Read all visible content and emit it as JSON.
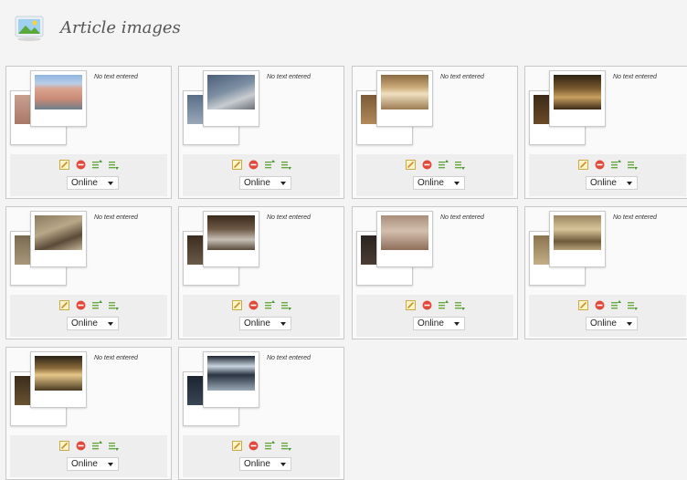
{
  "header": {
    "title": "Article images",
    "icon": "image-gallery-icon"
  },
  "cards": [
    {
      "note": "No text entered",
      "status": "Online",
      "front": "linear-gradient(180deg,#8fb4e0 0%,#b9cfe8 25%,#d9a48f 40%,#c98a76 70%,#6d7f8a 100%)",
      "back": "linear-gradient(180deg,#c9a090,#a87868)"
    },
    {
      "note": "No text entered",
      "status": "Online",
      "front": "linear-gradient(160deg,#4b5f7a 0%,#7d8fa3 45%,#c9ccd0 70%,#6b6f78 100%)",
      "back": "linear-gradient(180deg,#5a6e88,#9aa8b8)"
    },
    {
      "note": "No text entered",
      "status": "Online",
      "front": "linear-gradient(180deg,#8a6a42 0%,#c9a877 35%,#f0e0c0 55%,#9c7c52 100%)",
      "back": "linear-gradient(180deg,#7a5a38,#b28a5a)"
    },
    {
      "note": "No text entered",
      "status": "Online",
      "front": "linear-gradient(180deg,#2e2214 0%,#7a5a30 40%,#c8a060 65%,#3a2a18 100%)",
      "back": "linear-gradient(180deg,#3a2a18,#6a4a28)"
    },
    {
      "note": "No text entered",
      "status": "Online",
      "front": "linear-gradient(160deg,#8a7a60 0%,#b9a888 40%,#5a4a38 70%,#c4b49a 100%)",
      "back": "linear-gradient(180deg,#7a6a52,#a89878)"
    },
    {
      "note": "No text entered",
      "status": "Online",
      "front": "linear-gradient(180deg,#3a2a1c 0%,#6e5a46 40%,#c7c0b6 70%,#5a4a3a 100%)",
      "back": "linear-gradient(180deg,#3c2c20,#6a5a48)"
    },
    {
      "note": "No text entered",
      "status": "Online",
      "front": "linear-gradient(180deg,#a98e7a 0%,#d4bfae 45%,#8e6e5a 100%)",
      "back": "linear-gradient(180deg,#2a2420,#4a3c34)"
    },
    {
      "note": "No text entered",
      "status": "Online",
      "front": "linear-gradient(180deg,#9a8560 0%,#d8c49a 40%,#6e5a3a 75%,#b7a27a 100%)",
      "back": "linear-gradient(180deg,#8a7450,#c4ae86)"
    },
    {
      "note": "No text entered",
      "status": "Online",
      "front": "linear-gradient(180deg,#2a2216 0%,#8a6a3c 35%,#e6c88a 55%,#4a3a22 100%)",
      "back": "linear-gradient(180deg,#3a2c1a,#6a5232)"
    },
    {
      "note": "No text entered",
      "status": "Online",
      "front": "linear-gradient(180deg,#1e2630 0%,#c8d4e0 30%,#2a3442 55%,#9aa8b6 100%)",
      "back": "linear-gradient(180deg,#1c2430,#3a4656)"
    }
  ],
  "tools": [
    {
      "name": "edit-icon"
    },
    {
      "name": "delete-icon"
    },
    {
      "name": "move-up-icon"
    },
    {
      "name": "move-down-icon"
    }
  ]
}
